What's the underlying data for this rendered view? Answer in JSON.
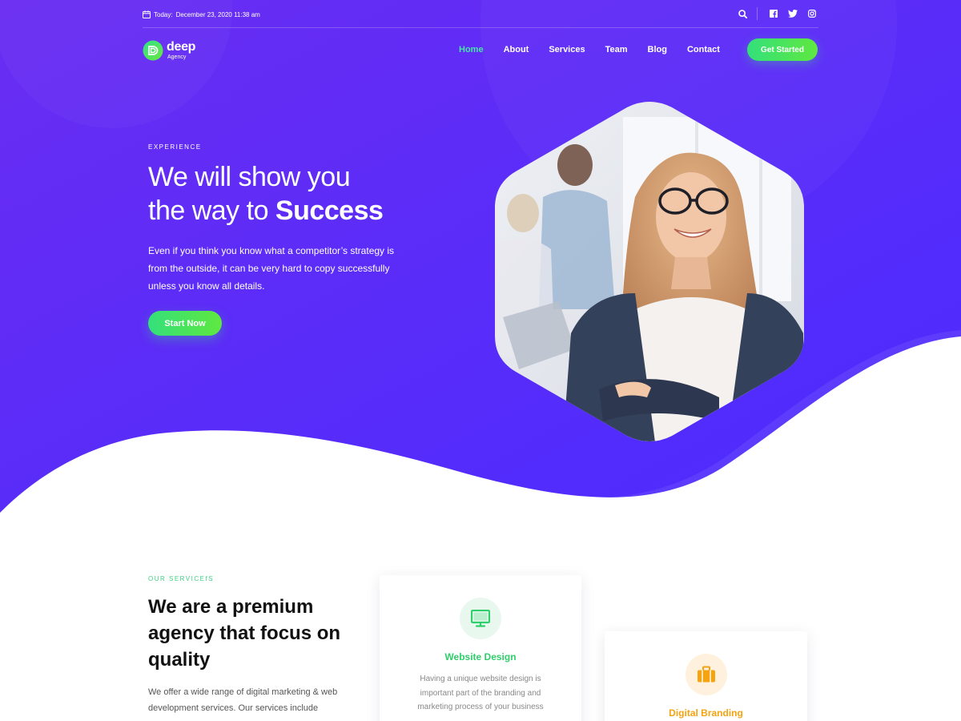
{
  "topbar": {
    "date_prefix": "Today:",
    "date_value": "December 23, 2020 11:38 am",
    "icons": [
      "calendar-icon",
      "search-icon",
      "facebook-icon",
      "twitter-icon",
      "instagram-icon"
    ]
  },
  "logo": {
    "name": "deep",
    "sub": "Agency"
  },
  "nav": {
    "items": [
      {
        "label": "Home",
        "active": true
      },
      {
        "label": "About"
      },
      {
        "label": "Services"
      },
      {
        "label": "Team"
      },
      {
        "label": "Blog"
      },
      {
        "label": "Contact"
      }
    ],
    "cta_label": "Get Started"
  },
  "hero": {
    "eyebrow": "EXPERIENCE",
    "title_line1": "We will show you",
    "title_line2_prefix": "the way to ",
    "title_line2_strong": "Success",
    "description": "Even if you think you know what a competitor’s strategy is from the outside, it can be very hard to copy successfully unless you know all details.",
    "button_label": "Start Now"
  },
  "services": {
    "eyebrow": "OUR SERVICEfS",
    "title": "We are a premium agency that focus on quality",
    "description": "We offer a wide range of digital marketing & web development services. Our services include",
    "cards": [
      {
        "title": "Website Design",
        "description": "Having a unique website design is important part of the branding and marketing process of your business",
        "icon": "monitor-icon",
        "color": "#2fcf6b"
      },
      {
        "title": "Digital Branding",
        "icon": "briefcase-icon",
        "color": "#f4a411"
      }
    ]
  },
  "colors": {
    "hero_gradient_start": "#6a2df2",
    "hero_gradient_end": "#4a2bff",
    "accent_green": "#3ed27f",
    "accent_orange": "#f4a411"
  }
}
